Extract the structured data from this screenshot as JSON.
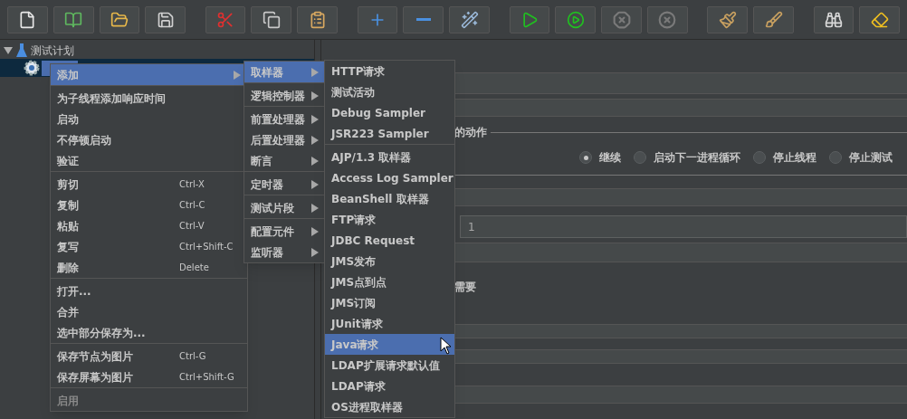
{
  "toolbar": [
    {
      "kind": "new",
      "disabled": false
    },
    {
      "kind": "templates",
      "disabled": false
    },
    {
      "kind": "open",
      "disabled": false
    },
    {
      "kind": "save",
      "disabled": false
    },
    {
      "kind": "cut",
      "disabled": false
    },
    {
      "kind": "copy",
      "disabled": false
    },
    {
      "kind": "paste",
      "disabled": false
    },
    {
      "kind": "expand",
      "disabled": false
    },
    {
      "kind": "collapse",
      "disabled": false
    },
    {
      "kind": "toggle",
      "disabled": false
    },
    {
      "kind": "start",
      "disabled": false
    },
    {
      "kind": "start_no_pause",
      "disabled": false
    },
    {
      "kind": "stop",
      "disabled": true
    },
    {
      "kind": "shutdown",
      "disabled": true
    },
    {
      "kind": "clear",
      "disabled": false
    },
    {
      "kind": "clear_all",
      "disabled": false
    },
    {
      "kind": "search",
      "disabled": false
    },
    {
      "kind": "reset_search",
      "disabled": false
    }
  ],
  "tree": {
    "label": "测试计划",
    "expanded": true,
    "children": [
      {
        "selected": true
      }
    ]
  },
  "panel": {
    "error_action_label": "的动作",
    "error_actions": [
      {
        "label": "继续",
        "selected": true
      },
      {
        "label": "启动下一进程循环",
        "selected": false
      },
      {
        "label": "停止线程",
        "selected": false
      },
      {
        "label": "停止测试",
        "selected": false
      }
    ],
    "field_value": "1",
    "note": "需要"
  },
  "context_menu": {
    "groups": [
      [
        {
          "label": "添加",
          "submenu": true,
          "selected": true,
          "disabled": false
        }
      ],
      [
        {
          "label": "为子线程添加响应时间",
          "submenu": false,
          "selected": false,
          "disabled": false
        },
        {
          "label": "启动",
          "submenu": false,
          "selected": false,
          "disabled": false
        },
        {
          "label": "不停顿启动",
          "submenu": false,
          "selected": false,
          "disabled": false
        },
        {
          "label": "验证",
          "submenu": false,
          "selected": false,
          "disabled": false
        }
      ],
      [
        {
          "label": "剪切",
          "shortcut": "Ctrl-X",
          "submenu": false,
          "selected": false,
          "disabled": false
        },
        {
          "label": "复制",
          "shortcut": "Ctrl-C",
          "submenu": false,
          "selected": false,
          "disabled": false
        },
        {
          "label": "粘贴",
          "shortcut": "Ctrl-V",
          "submenu": false,
          "selected": false,
          "disabled": false
        },
        {
          "label": "复写",
          "shortcut": "Ctrl+Shift-C",
          "submenu": false,
          "selected": false,
          "disabled": false
        },
        {
          "label": "删除",
          "shortcut": "Delete",
          "submenu": false,
          "selected": false,
          "disabled": false
        }
      ],
      [
        {
          "label": "打开...",
          "submenu": false,
          "selected": false,
          "disabled": false
        },
        {
          "label": "合并",
          "submenu": false,
          "selected": false,
          "disabled": false
        },
        {
          "label": "选中部分保存为...",
          "submenu": false,
          "selected": false,
          "disabled": false
        }
      ],
      [
        {
          "label": "保存节点为图片",
          "shortcut": "Ctrl-G",
          "submenu": false,
          "selected": false,
          "disabled": false
        },
        {
          "label": "保存屏幕为图片",
          "shortcut": "Ctrl+Shift-G",
          "submenu": false,
          "selected": false,
          "disabled": false
        }
      ],
      [
        {
          "label": "启用",
          "submenu": false,
          "selected": false,
          "disabled": true
        }
      ]
    ]
  },
  "add_submenu": {
    "groups": [
      [
        {
          "label": "取样器",
          "submenu": true,
          "selected": true,
          "disabled": false
        }
      ],
      [
        {
          "label": "逻辑控制器",
          "submenu": true,
          "selected": false,
          "disabled": false
        }
      ],
      [
        {
          "label": "前置处理器",
          "submenu": true,
          "selected": false,
          "disabled": false
        },
        {
          "label": "后置处理器",
          "submenu": true,
          "selected": false,
          "disabled": false
        },
        {
          "label": "断言",
          "submenu": true,
          "selected": false,
          "disabled": false
        }
      ],
      [
        {
          "label": "定时器",
          "submenu": true,
          "selected": false,
          "disabled": false
        }
      ],
      [
        {
          "label": "测试片段",
          "submenu": true,
          "selected": false,
          "disabled": false
        }
      ],
      [
        {
          "label": "配置元件",
          "submenu": true,
          "selected": false,
          "disabled": false
        },
        {
          "label": "监听器",
          "submenu": true,
          "selected": false,
          "disabled": false
        }
      ]
    ]
  },
  "sampler_submenu": {
    "groups": [
      [
        {
          "label": "HTTP请求",
          "submenu": false,
          "selected": false,
          "disabled": false
        },
        {
          "label": "测试活动",
          "submenu": false,
          "selected": false,
          "disabled": false
        },
        {
          "label": "Debug Sampler",
          "submenu": false,
          "selected": false,
          "disabled": false
        },
        {
          "label": "JSR223 Sampler",
          "submenu": false,
          "selected": false,
          "disabled": false
        }
      ],
      [
        {
          "label": "AJP/1.3 取样器",
          "submenu": false,
          "selected": false,
          "disabled": false
        },
        {
          "label": "Access Log Sampler",
          "submenu": false,
          "selected": false,
          "disabled": false
        },
        {
          "label": "BeanShell 取样器",
          "submenu": false,
          "selected": false,
          "disabled": false
        },
        {
          "label": "FTP请求",
          "submenu": false,
          "selected": false,
          "disabled": false
        },
        {
          "label": "JDBC Request",
          "submenu": false,
          "selected": false,
          "disabled": false
        },
        {
          "label": "JMS发布",
          "submenu": false,
          "selected": false,
          "disabled": false
        },
        {
          "label": "JMS点到点",
          "submenu": false,
          "selected": false,
          "disabled": false
        },
        {
          "label": "JMS订阅",
          "submenu": false,
          "selected": false,
          "disabled": false
        },
        {
          "label": "JUnit请求",
          "submenu": false,
          "selected": false,
          "disabled": false
        },
        {
          "label": "Java请求",
          "submenu": false,
          "selected": true,
          "disabled": false
        },
        {
          "label": "LDAP扩展请求默认值",
          "submenu": false,
          "selected": false,
          "disabled": false
        },
        {
          "label": "LDAP请求",
          "submenu": false,
          "selected": false,
          "disabled": false
        },
        {
          "label": "OS进程取样器",
          "submenu": false,
          "selected": false,
          "disabled": false
        }
      ]
    ]
  }
}
